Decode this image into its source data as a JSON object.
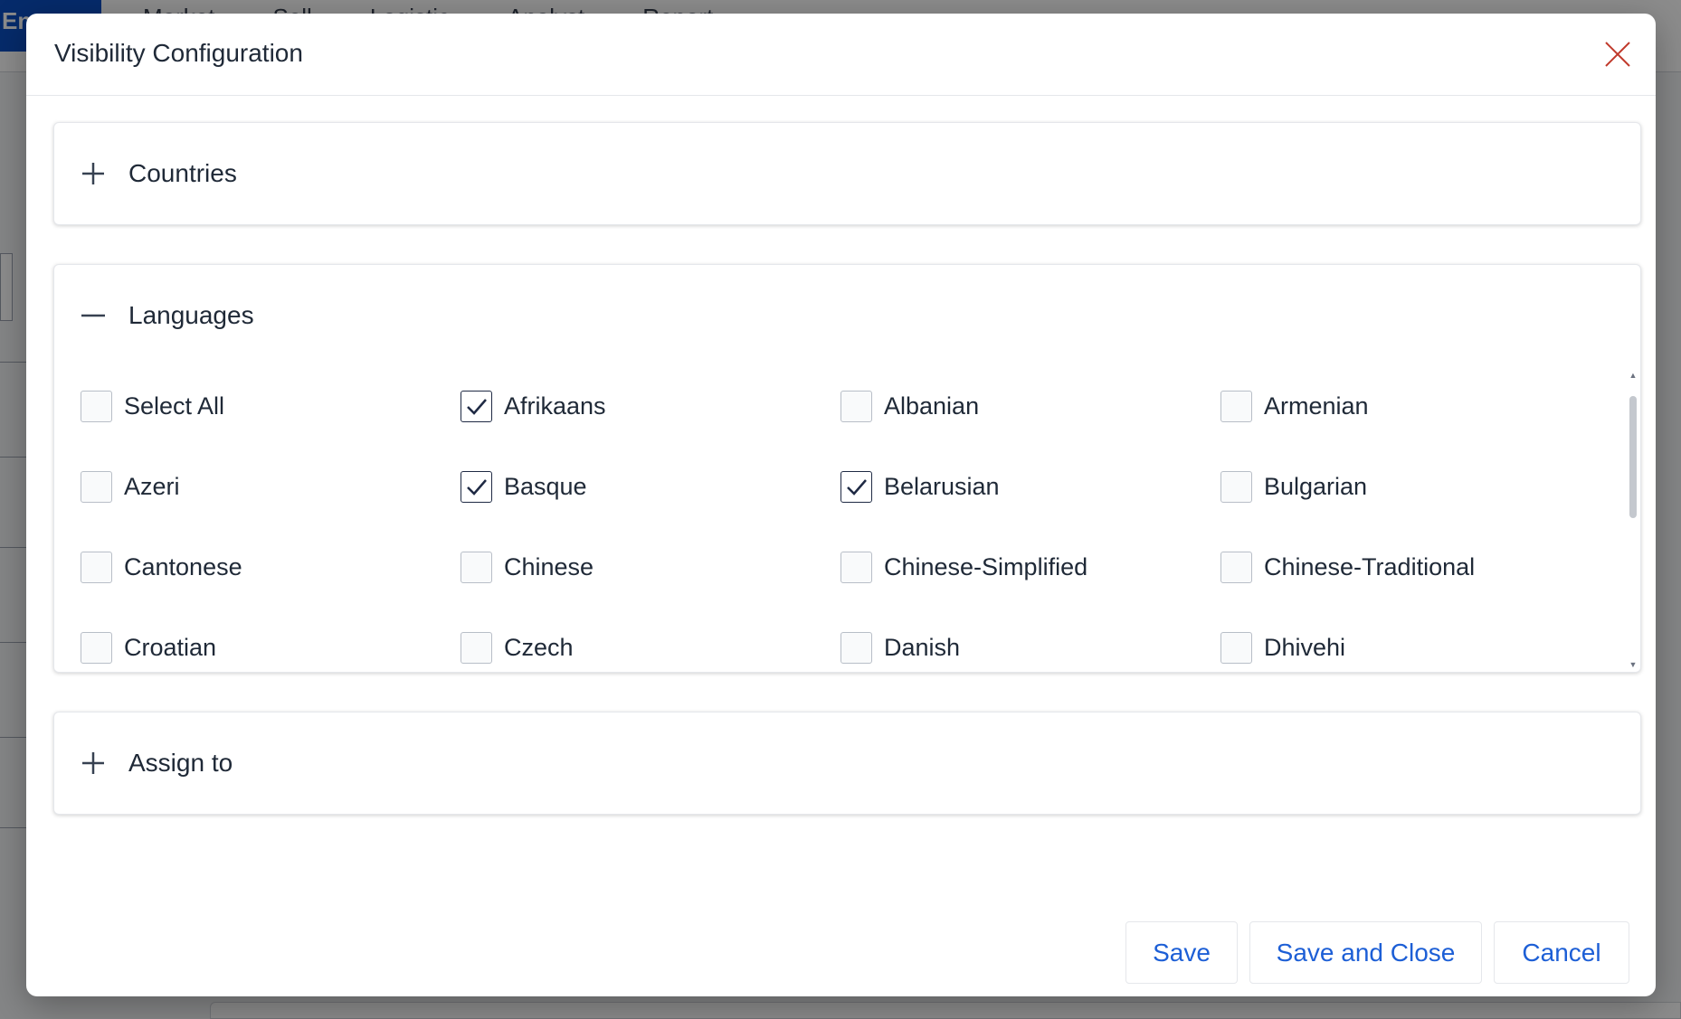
{
  "background": {
    "brand": "En",
    "menu_items": [
      "Market",
      "Sell",
      "Logistic",
      "Analyst",
      "Report"
    ]
  },
  "modal": {
    "title": "Visibility Configuration",
    "close_icon": "close-icon"
  },
  "sections": {
    "countries": {
      "title": "Countries",
      "expanded": false
    },
    "languages": {
      "title": "Languages",
      "expanded": true,
      "select_all": {
        "label": "Select All",
        "checked": false
      },
      "items": [
        {
          "label": "Afrikaans",
          "checked": true
        },
        {
          "label": "Albanian",
          "checked": false
        },
        {
          "label": "Armenian",
          "checked": false
        },
        {
          "label": "Azeri",
          "checked": false
        },
        {
          "label": "Basque",
          "checked": true
        },
        {
          "label": "Belarusian",
          "checked": true
        },
        {
          "label": "Bulgarian",
          "checked": false
        },
        {
          "label": "Cantonese",
          "checked": false
        },
        {
          "label": "Chinese",
          "checked": false
        },
        {
          "label": "Chinese-Simplified",
          "checked": false
        },
        {
          "label": "Chinese-Traditional",
          "checked": false
        },
        {
          "label": "Croatian",
          "checked": false
        },
        {
          "label": "Czech",
          "checked": false
        },
        {
          "label": "Danish",
          "checked": false
        },
        {
          "label": "Dhivehi",
          "checked": false
        }
      ]
    },
    "assign_to": {
      "title": "Assign to",
      "expanded": false
    }
  },
  "footer": {
    "save_label": "Save",
    "save_close_label": "Save and Close",
    "cancel_label": "Cancel"
  },
  "colors": {
    "accent": "#1d5fd6",
    "close_icon": "#c0392b",
    "brand": "#0b4fc4"
  }
}
